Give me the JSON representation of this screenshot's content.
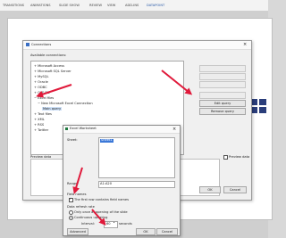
{
  "ribbon": {
    "tabs": [
      "TRANSITIONS",
      "ANIMATIONS",
      "SLIDE SHOW",
      "REVIEW",
      "VIEW",
      "ADD-INS",
      "DATAPOINT"
    ]
  },
  "connections": {
    "title": "Connections",
    "available_label": "Available connections:",
    "items": [
      "Microsoft Access",
      "Microsoft SQL Server",
      "MySQL",
      "Oracle",
      "ODBC",
      "OLE DB",
      "Excel files",
      "New Microsoft Excel Connection",
      "Main query",
      "Text files",
      "XML",
      "RSS",
      "Twitter"
    ],
    "side_buttons": [
      "Edit query",
      "Remove query"
    ],
    "preview_label": "Preview data",
    "preview_checkbox": "Preview data",
    "ok": "OK",
    "cancel": "Cancel"
  },
  "excel_dialog": {
    "title": "Excel Worksheet",
    "sheet_label": "Sheet:",
    "sheet_value": "Sheet1",
    "range_label": "Range:",
    "range_value": "A1:A20",
    "field_names_heading": "Field names",
    "field_names_checkbox": "The first row contains field names",
    "refresh_heading": "Data refresh rate",
    "refresh_once": "Only once at opening of the slide",
    "refresh_continuous": "Continuous updating",
    "interval_label": "Interval:",
    "interval_value": "60",
    "interval_unit": "seconds",
    "advanced": "Advanced",
    "ok": "OK",
    "cancel": "Cancel"
  }
}
